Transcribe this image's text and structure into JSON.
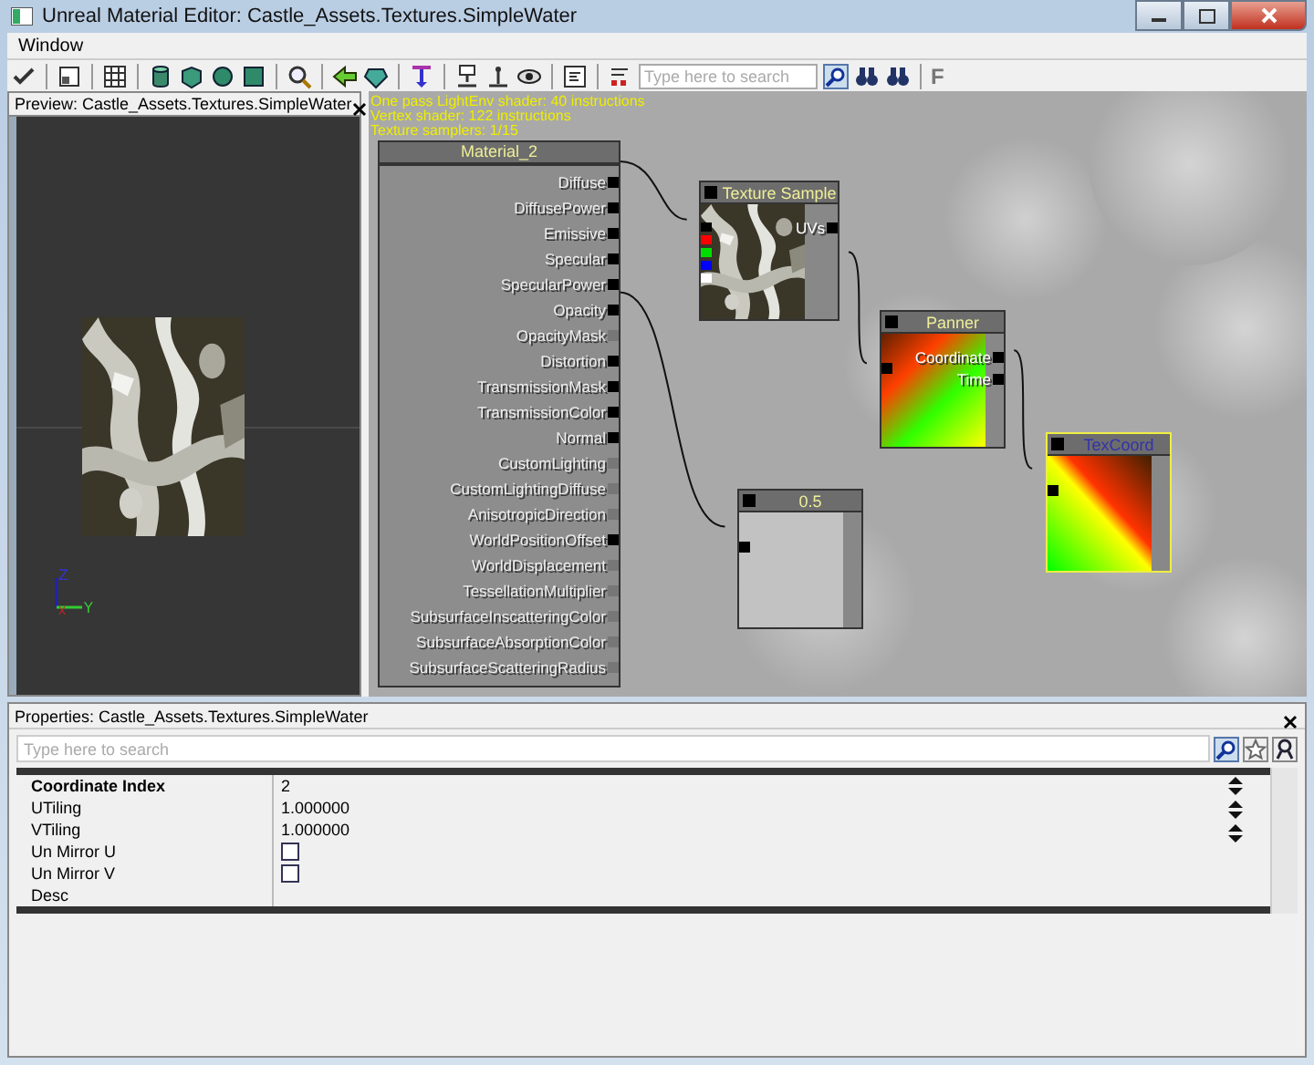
{
  "window": {
    "title": "Unreal Material Editor: Castle_Assets.Textures.SimpleWater"
  },
  "menu": [
    "Window"
  ],
  "toolbar": [
    {
      "kind": "check"
    },
    {
      "kind": "sep"
    },
    {
      "kind": "layout"
    },
    {
      "kind": "sep"
    },
    {
      "kind": "grid"
    },
    {
      "kind": "sep"
    },
    {
      "kind": "cylinder"
    },
    {
      "kind": "cube"
    },
    {
      "kind": "sphere"
    },
    {
      "kind": "plane"
    },
    {
      "kind": "sep"
    },
    {
      "kind": "magnifier"
    },
    {
      "kind": "sep"
    },
    {
      "kind": "arrow"
    },
    {
      "kind": "gem"
    },
    {
      "kind": "sep"
    },
    {
      "kind": "pin"
    },
    {
      "kind": "sep"
    },
    {
      "kind": "node"
    },
    {
      "kind": "anchor"
    },
    {
      "kind": "eye"
    },
    {
      "kind": "sep"
    },
    {
      "kind": "text"
    },
    {
      "kind": "sep"
    },
    {
      "kind": "stats"
    },
    {
      "kind": "search",
      "placeholder": "Type here to search"
    },
    {
      "kind": "find"
    },
    {
      "kind": "binoculars"
    },
    {
      "kind": "binoculars"
    },
    {
      "kind": "sep"
    },
    {
      "kind": "letter",
      "label": "F"
    }
  ],
  "preview": {
    "title": "Preview: Castle_Assets.Textures.SimpleWater",
    "axes": [
      "Z",
      "X",
      "Y"
    ]
  },
  "stats": [
    "One pass LightEnv shader: 40 instructions",
    "Vertex shader: 122 instructions",
    "Texture samplers: 1/15"
  ],
  "material_node": {
    "title": "Material_2",
    "pins": [
      {
        "label": "Diffuse",
        "enabled": true
      },
      {
        "label": "DiffusePower",
        "enabled": true
      },
      {
        "label": "Emissive",
        "enabled": true
      },
      {
        "label": "Specular",
        "enabled": true
      },
      {
        "label": "SpecularPower",
        "enabled": true
      },
      {
        "label": "Opacity",
        "enabled": true
      },
      {
        "label": "OpacityMask",
        "enabled": false
      },
      {
        "label": "Distortion",
        "enabled": true
      },
      {
        "label": "TransmissionMask",
        "enabled": true
      },
      {
        "label": "TransmissionColor",
        "enabled": true
      },
      {
        "label": "Normal",
        "enabled": true
      },
      {
        "label": "CustomLighting",
        "enabled": false
      },
      {
        "label": "CustomLightingDiffuse",
        "enabled": false
      },
      {
        "label": "AnisotropicDirection",
        "enabled": false
      },
      {
        "label": "WorldPositionOffset",
        "enabled": true
      },
      {
        "label": "WorldDisplacement",
        "enabled": false
      },
      {
        "label": "TessellationMultiplier",
        "enabled": false
      },
      {
        "label": "SubsurfaceInscatteringColor",
        "enabled": false
      },
      {
        "label": "SubsurfaceAbsorptionColor",
        "enabled": false
      },
      {
        "label": "SubsurfaceScatteringRadius",
        "enabled": false
      }
    ]
  },
  "nodes": [
    {
      "kind": "texture",
      "title": "Texture Sample",
      "selected": false,
      "inputs": [
        {
          "color": "#000000"
        },
        {
          "color": "#ff0000"
        },
        {
          "color": "#00e000"
        },
        {
          "color": "#0000ff"
        },
        {
          "color": "#ffffff"
        }
      ],
      "outputs": [
        "UVs"
      ]
    },
    {
      "kind": "gradient",
      "title": "Panner",
      "selected": false,
      "outputs": [
        "Coordinate",
        "Time"
      ]
    },
    {
      "kind": "gradient",
      "title": "TexCoord",
      "selected": true
    },
    {
      "kind": "constant",
      "title": "0.5",
      "selected": false
    }
  ],
  "properties": {
    "title": "Properties: Castle_Assets.Textures.SimpleWater",
    "search": {
      "placeholder": "Type here to search"
    },
    "rows": [
      {
        "label": "Coordinate Index",
        "kind": "text",
        "value": "2",
        "selected": true
      },
      {
        "label": "UTiling",
        "kind": "text",
        "value": "1.000000",
        "selected": false
      },
      {
        "label": "VTiling",
        "kind": "text",
        "value": "1.000000",
        "selected": false
      },
      {
        "label": "Un Mirror U",
        "kind": "checkbox",
        "checked": false,
        "selected": false
      },
      {
        "label": "Un Mirror V",
        "kind": "checkbox",
        "checked": false,
        "selected": false
      },
      {
        "label": "Desc",
        "kind": "text",
        "value": "",
        "selected": false
      }
    ]
  }
}
